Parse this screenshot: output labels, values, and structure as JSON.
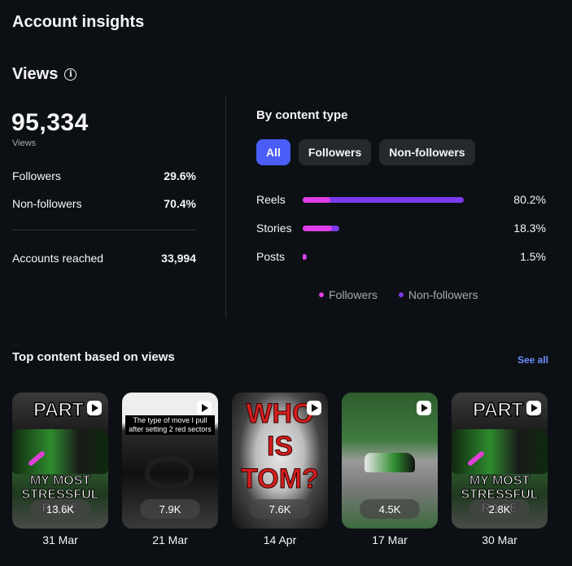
{
  "page_title": "Account insights",
  "views": {
    "title": "Views",
    "info_icon": "info-icon",
    "total": "95,334",
    "total_label": "Views",
    "followers_label": "Followers",
    "followers_value": "29.6%",
    "nonfollowers_label": "Non-followers",
    "nonfollowers_value": "70.4%",
    "reached_label": "Accounts reached",
    "reached_value": "33,994"
  },
  "content_type": {
    "title": "By content type",
    "tabs": [
      "All",
      "Followers",
      "Non-followers"
    ],
    "active_tab": "All",
    "rows": [
      {
        "label": "Reels",
        "percent": "80.2%",
        "share": 80.2,
        "followers_share": 0.17
      },
      {
        "label": "Stories",
        "percent": "18.3%",
        "share": 18.3,
        "followers_share": 0.8
      },
      {
        "label": "Posts",
        "percent": "1.5%",
        "share": 1.5,
        "followers_share": 0.3
      }
    ],
    "legend": {
      "followers": "Followers",
      "nonfollowers": "Non-followers"
    },
    "colors": {
      "followers": "#e03ee6",
      "nonfollowers": "#7c3aed",
      "active_tab": "#4a5df9"
    }
  },
  "top_content": {
    "title": "Top content based on views",
    "see_all": "See all",
    "items": [
      {
        "views": "13.6K",
        "date": "31 Mar",
        "overlay_top": "PART 2",
        "overlay_bottom": "MY MOST STRESSFUL RACE"
      },
      {
        "views": "7.9K",
        "date": "21 Mar",
        "overlay_top": "The type of move I pull after setting 2 red sectors"
      },
      {
        "views": "7.6K",
        "date": "14 Apr",
        "overlay_top": "WHO IS TOM?"
      },
      {
        "views": "4.5K",
        "date": "17 Mar"
      },
      {
        "views": "2.8K",
        "date": "30 Mar",
        "overlay_top": "PART 1",
        "overlay_bottom": "MY MOST STRESSFUL RACE"
      }
    ]
  }
}
